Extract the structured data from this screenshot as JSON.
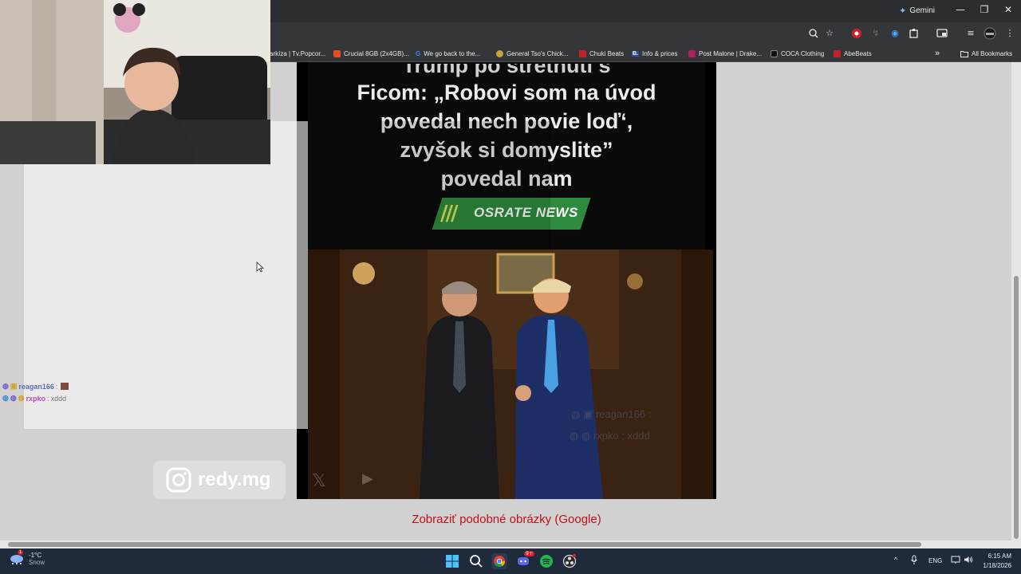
{
  "browser": {
    "gemini_label": "Gemini",
    "window_controls": {
      "minimize": "—",
      "restore": "❐",
      "close": "✕"
    },
    "toolbar_icons": [
      "zoom-icon",
      "star-icon",
      "extension-red-icon",
      "extension-gray-icon",
      "extension-blue-icon",
      "puzzle-icon",
      "screen-icon",
      "queue-icon",
      "profile-avatar",
      "menu-icon"
    ],
    "bookmarks": [
      {
        "label": "arkíza | Tv.Popcor...",
        "color": "#3a3a3a"
      },
      {
        "label": "Crucial 8GB (2x4GB)...",
        "color": "#e05020"
      },
      {
        "label": "We go back to the...",
        "color": "#4285f4",
        "icon_text": "G"
      },
      {
        "label": "General Tso's Chick...",
        "color": "#c8a040"
      },
      {
        "label": "Chuki Beats",
        "color": "#c0222a"
      },
      {
        "label": "Info & prices",
        "color": "#2a4fb0",
        "icon_text": "B."
      },
      {
        "label": "Post Malone | Drake...",
        "color": "#b0205a"
      },
      {
        "label": "COCA Clothing",
        "color": "#222222"
      },
      {
        "label": "AbeBeats",
        "color": "#c0222a"
      }
    ],
    "bookmarks_overflow": "»",
    "all_bookmarks_label": "All Bookmarks"
  },
  "meme": {
    "headline_line0": "Trump po stretnutí s",
    "headline_line1": "Ficom: „Robovi som na úvod",
    "headline_line2": "povedal nech povie loď‘,",
    "headline_line3": "zvyšok si domyslite”",
    "headline_line4": "povedal nam",
    "badge_stripes": "///",
    "badge_text": "OSRATE NEWS"
  },
  "overlay": {
    "chat": [
      {
        "user": "reagan166",
        "message": ""
      },
      {
        "user": "rxpko",
        "message": "xddd"
      }
    ],
    "ghost_chat": [
      {
        "user": "reagan166",
        "message": ""
      },
      {
        "user": "rxpko",
        "message": "xddd"
      }
    ],
    "instagram_handle": "redy.mg",
    "ghost_x": "𝕏",
    "ghost_youtube": "▶"
  },
  "page": {
    "similar_images_link": "Zobraziť podobné obrázky (Google)"
  },
  "taskbar": {
    "weather_temp": "-1°C",
    "weather_desc": "Snow",
    "weather_badge": "1",
    "discord_badge": "9+",
    "tray_chevron": "^",
    "tray_lang": "ENG",
    "time": "6:15 AM",
    "date": "1/18/2026"
  },
  "colors": {
    "chrome_dark": "#35363a",
    "link_red": "#c0101a",
    "badge_green": "#2e8b3e"
  }
}
